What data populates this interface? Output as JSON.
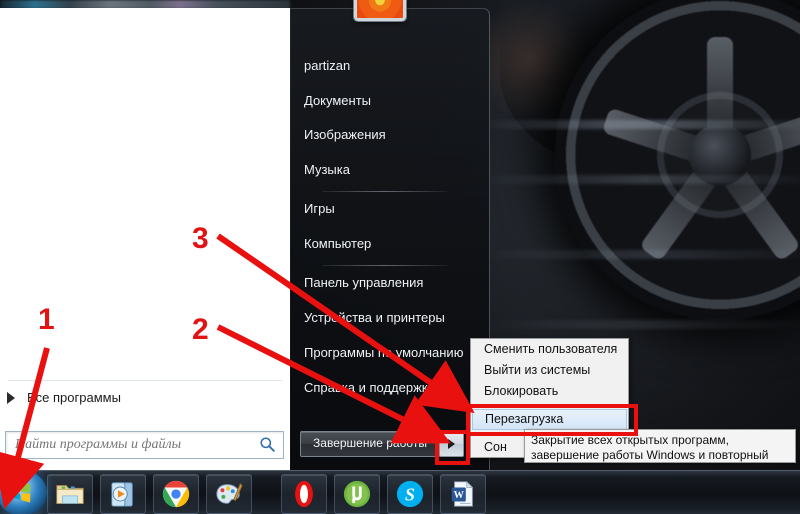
{
  "os": {
    "name": "Windows 7",
    "accent_red": "#e8110f",
    "menu_bg": "#101418"
  },
  "start_menu": {
    "user": {
      "name_label": "partizan",
      "avatar_icon": "flower-avatar"
    },
    "right_items": [
      {
        "label": "partizan",
        "sep_after": false
      },
      {
        "label": "Документы",
        "sep_after": false
      },
      {
        "label": "Изображения",
        "sep_after": false
      },
      {
        "label": "Музыка",
        "sep_after": true
      },
      {
        "label": "Игры",
        "sep_after": false
      },
      {
        "label": "Компьютер",
        "sep_after": true
      },
      {
        "label": "Панель управления",
        "sep_after": false
      },
      {
        "label": "Устройства и принтеры",
        "sep_after": false
      },
      {
        "label": "Программы по умолчанию",
        "sep_after": false
      },
      {
        "label": "Справка и поддержка",
        "sep_after": false
      }
    ],
    "all_programs": {
      "label": "Все программы",
      "arrow_icon": "chevron-right-icon"
    },
    "search": {
      "placeholder": "Найти программы и файлы",
      "value": "",
      "icon": "search-icon"
    },
    "shutdown": {
      "label": "Завершение работы",
      "arrow_icon": "chevron-right-icon"
    }
  },
  "context_menu": {
    "items": [
      {
        "label": "Сменить пользователя",
        "highlighted": false
      },
      {
        "label": "Выйти из системы",
        "highlighted": false
      },
      {
        "label": "Блокировать",
        "highlighted": false
      },
      {
        "label": "Перезагрузка",
        "highlighted": true
      },
      {
        "label": "Сон",
        "highlighted": false
      }
    ]
  },
  "tooltip": {
    "text": "Закрытие всех открытых программ, завершение работы Windows и повторный запуск Windows."
  },
  "taskbar": {
    "start_orb": {
      "name": "start-orb",
      "icon": "windows-logo-icon"
    },
    "items": [
      {
        "icon": "explorer-icon",
        "label": "Проводник"
      },
      {
        "icon": "media-player-icon",
        "label": "Windows Media Player"
      },
      {
        "icon": "chrome-icon",
        "label": "Google Chrome"
      },
      {
        "icon": "paint-icon",
        "label": "Paint"
      },
      {
        "icon": "opera-icon",
        "label": "Opera"
      },
      {
        "icon": "utorrent-icon",
        "label": "uTorrent"
      },
      {
        "icon": "skype-icon",
        "label": "Skype"
      },
      {
        "icon": "word-icon",
        "label": "Microsoft Word"
      }
    ]
  },
  "annotations": {
    "steps": [
      {
        "number": "1",
        "target": "start-orb"
      },
      {
        "number": "2",
        "target": "shutdown-arrow-button"
      },
      {
        "number": "3",
        "target": "restart-menu-item"
      }
    ]
  }
}
